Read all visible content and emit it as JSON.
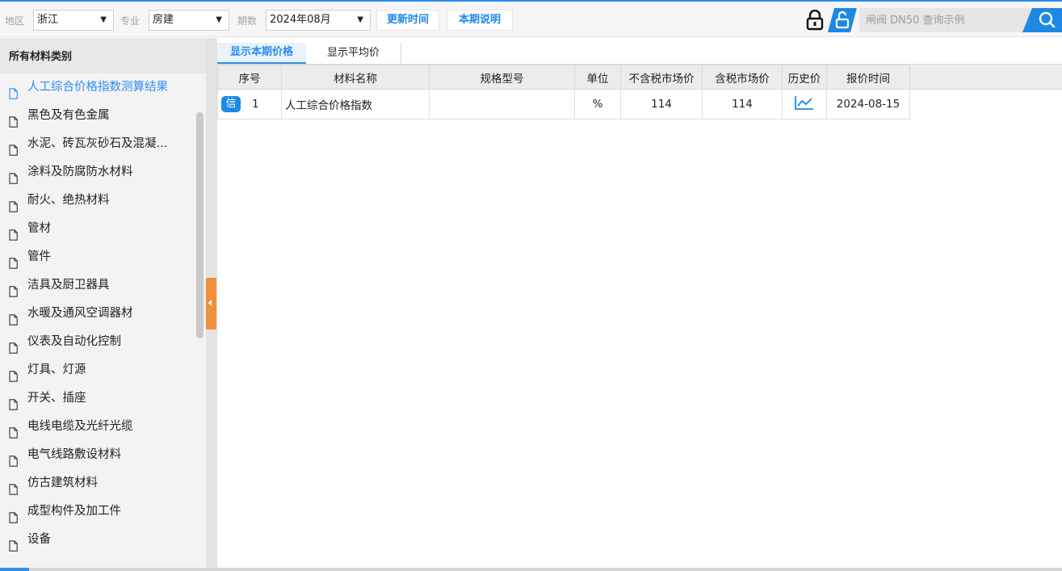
{
  "toolbar": {
    "region_label": "地区",
    "region_value": "浙江",
    "major_label": "专业",
    "major_value": "房建",
    "period_label": "期数",
    "period_value": "2024年08月",
    "update_time_button": "更新时间",
    "period_note_button": "本期说明",
    "search_placeholder": "闸阀 DN50 查询示例",
    "icons": [
      "lock-icon",
      "unlock-icon",
      "search-icon"
    ],
    "accent_color": "#2d8cf0"
  },
  "sidebar": {
    "title": "所有材料类别",
    "items": [
      {
        "label": "人工综合价格指数测算结果",
        "active": true
      },
      {
        "label": "黑色及有色金属"
      },
      {
        "label": "水泥、砖瓦灰砂石及混凝..."
      },
      {
        "label": "涂料及防腐防水材料"
      },
      {
        "label": "耐火、绝热材料"
      },
      {
        "label": "管材"
      },
      {
        "label": "管件"
      },
      {
        "label": "洁具及厨卫器具"
      },
      {
        "label": "水暖及通风空调器材"
      },
      {
        "label": "仪表及自动化控制"
      },
      {
        "label": "灯具、灯源"
      },
      {
        "label": "开关、插座"
      },
      {
        "label": "电线电缆及光纤光缆"
      },
      {
        "label": "电气线路敷设材料"
      },
      {
        "label": "仿古建筑材料"
      },
      {
        "label": "成型构件及加工件"
      },
      {
        "label": "设备"
      }
    ]
  },
  "main": {
    "tabs": [
      "显示本期价格",
      "显示平均价"
    ],
    "table": {
      "columns": [
        "序号",
        "材料名称",
        "规格型号",
        "单位",
        "不含税市场价",
        "含税市场价",
        "历史价",
        "报价时间"
      ],
      "rows": [
        {
          "badge": "信",
          "index": "1",
          "name": "人工综合价格指数",
          "spec": "",
          "unit": "%",
          "price_ex_tax": "114",
          "price_inc_tax": "114",
          "history_icon": "trend-chart-icon",
          "quote_date": "2024-08-15"
        }
      ]
    }
  }
}
